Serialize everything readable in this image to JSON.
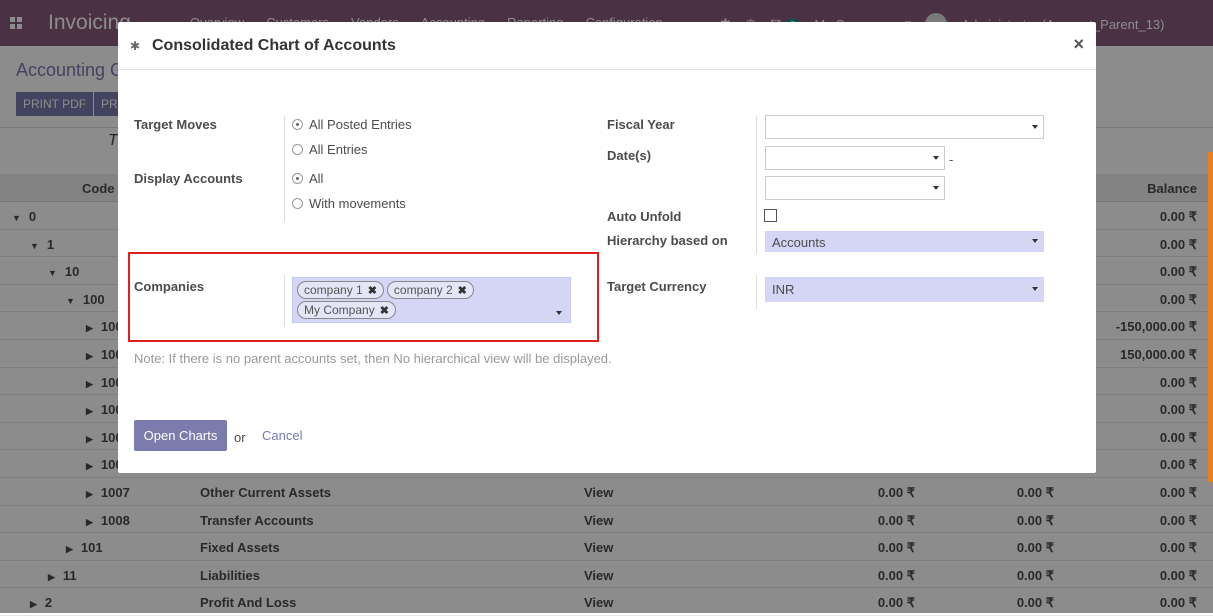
{
  "app": {
    "brand": "Invoicing",
    "menu": [
      "Overview",
      "Customers",
      "Vendors",
      "Accounting",
      "Reporting",
      "Configuration"
    ],
    "company": "My Company",
    "user": "Administrator (Account_Parent_13)",
    "chat_count": "3"
  },
  "page": {
    "breadcrumb": "Accounting G",
    "print_pdf": "PRINT PDF",
    "print_xls": "PR",
    "report_title": "T",
    "report_side": "s"
  },
  "table": {
    "headers": {
      "code": "Code",
      "balance": "Balance"
    },
    "rows": [
      {
        "code": "0",
        "name": "",
        "type": "",
        "debit": "",
        "credit": "",
        "balance": "0.00 ₹",
        "caret": "▼"
      },
      {
        "code": "1",
        "name": "",
        "type": "",
        "debit": "",
        "credit": "",
        "balance": "0.00 ₹",
        "caret": "▼"
      },
      {
        "code": "10",
        "name": "",
        "type": "",
        "debit": "",
        "credit": "",
        "balance": "0.00 ₹",
        "caret": "▼"
      },
      {
        "code": "100",
        "name": "",
        "type": "",
        "debit": "",
        "credit": "",
        "balance": "0.00 ₹",
        "caret": "▼"
      },
      {
        "code": "100",
        "name": "",
        "type": "",
        "debit": "",
        "credit": "",
        "balance": "-150,000.00 ₹",
        "caret": "▶"
      },
      {
        "code": "100",
        "name": "",
        "type": "",
        "debit": "",
        "credit": "",
        "balance": "150,000.00 ₹",
        "caret": "▶"
      },
      {
        "code": "100",
        "name": "",
        "type": "",
        "debit": "",
        "credit": "",
        "balance": "0.00 ₹",
        "caret": "▶"
      },
      {
        "code": "100",
        "name": "",
        "type": "",
        "debit": "",
        "credit": "",
        "balance": "0.00 ₹",
        "caret": "▶"
      },
      {
        "code": "100",
        "name": "",
        "type": "",
        "debit": "",
        "credit": "",
        "balance": "0.00 ₹",
        "caret": "▶"
      },
      {
        "code": "100",
        "name": "",
        "type": "",
        "debit": "",
        "credit": "",
        "balance": "0.00 ₹",
        "caret": "▶"
      },
      {
        "code": "1007",
        "name": "Other Current Assets",
        "type": "View",
        "debit": "0.00 ₹",
        "credit": "0.00 ₹",
        "balance": "0.00 ₹",
        "caret": "▶"
      },
      {
        "code": "1008",
        "name": "Transfer Accounts",
        "type": "View",
        "debit": "0.00 ₹",
        "credit": "0.00 ₹",
        "balance": "0.00 ₹",
        "caret": "▶"
      },
      {
        "code": "101",
        "name": "Fixed Assets",
        "type": "View",
        "debit": "0.00 ₹",
        "credit": "0.00 ₹",
        "balance": "0.00 ₹",
        "caret": "▶"
      },
      {
        "code": "11",
        "name": "Liabilities",
        "type": "View",
        "debit": "0.00 ₹",
        "credit": "0.00 ₹",
        "balance": "0.00 ₹",
        "caret": "▶"
      },
      {
        "code": "2",
        "name": "Profit And Loss",
        "type": "View",
        "debit": "0.00 ₹",
        "credit": "0.00 ₹",
        "balance": "0.00 ₹",
        "caret": "▶"
      }
    ]
  },
  "modal": {
    "title": "Consolidated Chart of Accounts",
    "target_moves_label": "Target Moves",
    "target_moves": [
      "All Posted Entries",
      "All Entries"
    ],
    "display_accounts_label": "Display Accounts",
    "display_accounts": [
      "All",
      "With movements"
    ],
    "companies_label": "Companies",
    "companies": [
      "company 1",
      "company 2",
      "My Company"
    ],
    "fiscal_year_label": "Fiscal Year",
    "dates_label": "Date(s)",
    "dates_separator": "-",
    "auto_unfold_label": "Auto Unfold",
    "hierarchy_label": "Hierarchy based on",
    "hierarchy_value": "Accounts",
    "target_currency_label": "Target Currency",
    "target_currency_value": "INR",
    "note": "Note: If there is no parent accounts set, then No hierarchical view will be displayed.",
    "open_button": "Open Charts",
    "or_text": "or",
    "cancel_link": "Cancel",
    "close_icon": "×"
  },
  "colors": {
    "brand": "#875a7b",
    "accent": "#7c7bad",
    "highlight": "#e02020"
  }
}
